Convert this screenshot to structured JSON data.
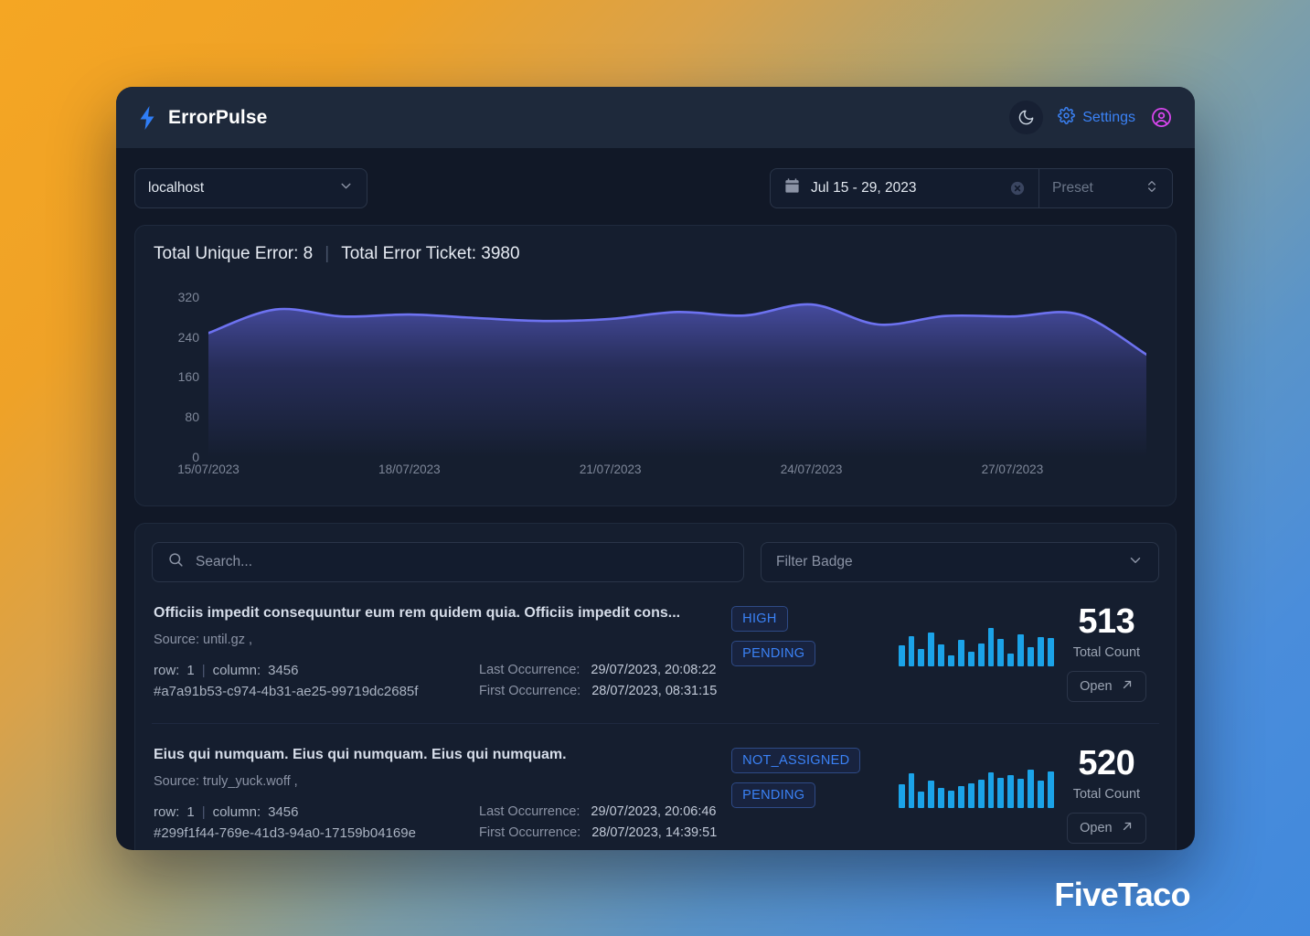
{
  "header": {
    "brand": "ErrorPulse",
    "logo_icon": "lightning-bolt-icon",
    "theme_toggle_icon": "moon-icon",
    "settings_icon": "gear-icon",
    "settings_label": "Settings",
    "account_icon": "user-circle-icon",
    "accent_blue": "#3b82f6",
    "accent_pink": "#d946ef"
  },
  "toolbar": {
    "host_select": {
      "value": "localhost",
      "chevron_icon": "chevron-down-icon"
    },
    "date_range": {
      "calendar_icon": "calendar-icon",
      "value": "Jul 15 - 29, 2023",
      "clear_icon": "clear-circle-icon"
    },
    "preset": {
      "label": "Preset",
      "icon": "chevron-up-down-icon"
    }
  },
  "summary": {
    "unique_label": "Total Unique Error: 8",
    "divider": "|",
    "ticket_label": "Total Error Ticket: 3980"
  },
  "chart_data": {
    "type": "area",
    "title": "",
    "xlabel": "",
    "ylabel": "",
    "ylim": [
      0,
      360
    ],
    "yticks": [
      320,
      240,
      160,
      80,
      0
    ],
    "grid": false,
    "legend": "none",
    "line_color": "#6d72f0",
    "fill_top_color": "#3b3f8f",
    "fill_bottom_color": "#151e2f",
    "xticks": [
      "15/07/2023",
      "18/07/2023",
      "21/07/2023",
      "24/07/2023",
      "27/07/2023"
    ],
    "x": [
      "15/07/2023",
      "16/07/2023",
      "17/07/2023",
      "18/07/2023",
      "19/07/2023",
      "20/07/2023",
      "21/07/2023",
      "22/07/2023",
      "23/07/2023",
      "24/07/2023",
      "25/07/2023",
      "26/07/2023",
      "27/07/2023",
      "28/07/2023",
      "29/07/2023"
    ],
    "values": [
      248,
      295,
      281,
      285,
      278,
      272,
      276,
      290,
      283,
      305,
      265,
      282,
      281,
      285,
      205
    ]
  },
  "filters": {
    "search_placeholder": "Search...",
    "search_value": "",
    "search_icon": "search-icon",
    "badge_filter_label": "Filter Badge",
    "badge_filter_icon": "chevron-down-icon"
  },
  "errors": [
    {
      "title": "Officiis impedit consequuntur eum rem quidem quia. Officiis impedit cons...",
      "source": "Source: until.gz ,",
      "row_label": "row:",
      "row_value": "1",
      "column_label": "column:",
      "column_value": "3456",
      "hash": "#a7a91b53-c974-4b31-ae25-99719dc2685f",
      "last_occurrence_label": "Last Occurrence:",
      "last_occurrence_value": "29/07/2023, 20:08:22",
      "first_occurrence_label": "First Occurrence:",
      "first_occurrence_value": "28/07/2023, 08:31:15",
      "badges": [
        "HIGH",
        "PENDING"
      ],
      "sparkline": [
        52,
        78,
        43,
        88,
        55,
        26,
        68,
        34,
        58,
        100,
        70,
        30,
        82,
        48,
        76,
        72
      ],
      "total_count": "513",
      "total_count_label": "Total Count",
      "open_label": "Open",
      "open_icon": "arrow-up-right-icon"
    },
    {
      "title": "Eius qui numquam. Eius qui numquam. Eius qui numquam.",
      "source": "Source: truly_yuck.woff ,",
      "row_label": "row:",
      "row_value": "1",
      "column_label": "column:",
      "column_value": "3456",
      "hash": "#299f1f44-769e-41d3-94a0-17159b04169e",
      "last_occurrence_label": "Last Occurrence:",
      "last_occurrence_value": "29/07/2023, 20:06:46",
      "first_occurrence_label": "First Occurrence:",
      "first_occurrence_value": "28/07/2023, 14:39:51",
      "badges": [
        "NOT_ASSIGNED",
        "PENDING"
      ],
      "sparkline": [
        56,
        82,
        36,
        64,
        46,
        40,
        50,
        58,
        66,
        86,
        72,
        78,
        70,
        92,
        64,
        88
      ],
      "total_count": "520",
      "total_count_label": "Total Count",
      "open_label": "Open",
      "open_icon": "arrow-up-right-icon"
    }
  ],
  "watermark": "FiveTaco"
}
